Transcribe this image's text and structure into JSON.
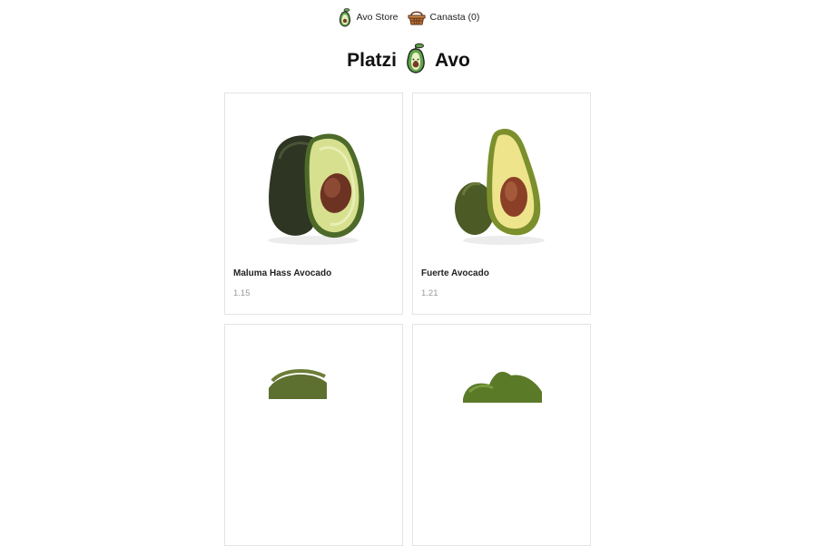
{
  "nav": {
    "store_label": "Avo Store",
    "cart_label": "Canasta (0)"
  },
  "header": {
    "title_left": "Platzi",
    "title_right": "Avo"
  },
  "products": [
    {
      "name": "Maluma Hass Avocado",
      "price": "1.15",
      "image_icon": "avocado-half-icon"
    },
    {
      "name": "Fuerte Avocado",
      "price": "1.21",
      "image_icon": "avocado-half-icon"
    },
    {
      "name": "",
      "price": "",
      "image_icon": "avocado-icon"
    },
    {
      "name": "",
      "price": "",
      "image_icon": "avocado-icon"
    }
  ],
  "colors": {
    "avocado_dark": "#2f3a25",
    "avocado_flesh": "#d9e39a",
    "avocado_pit": "#7a3b24",
    "logo_green": "#5fa64a",
    "price_gray": "#999999"
  }
}
